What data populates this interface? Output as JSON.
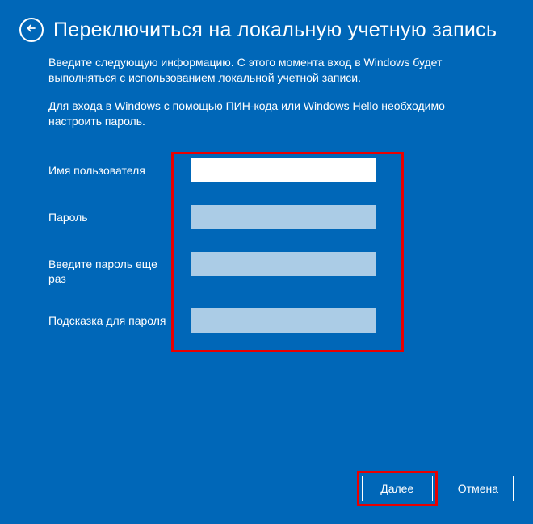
{
  "header": {
    "title": "Переключиться на локальную учетную запись"
  },
  "description": {
    "line1": "Введите следующую информацию. С этого момента вход в Windows будет выполняться с использованием локальной учетной записи.",
    "line2": "Для входа в Windows с помощью ПИН-кода или Windows Hello необходимо настроить пароль."
  },
  "form": {
    "username": {
      "label": "Имя пользователя",
      "value": ""
    },
    "password": {
      "label": "Пароль",
      "value": ""
    },
    "confirm": {
      "label": "Введите пароль еще раз",
      "value": ""
    },
    "hint": {
      "label": "Подсказка для пароля",
      "value": ""
    }
  },
  "buttons": {
    "next": "Далее",
    "cancel": "Отмена"
  }
}
